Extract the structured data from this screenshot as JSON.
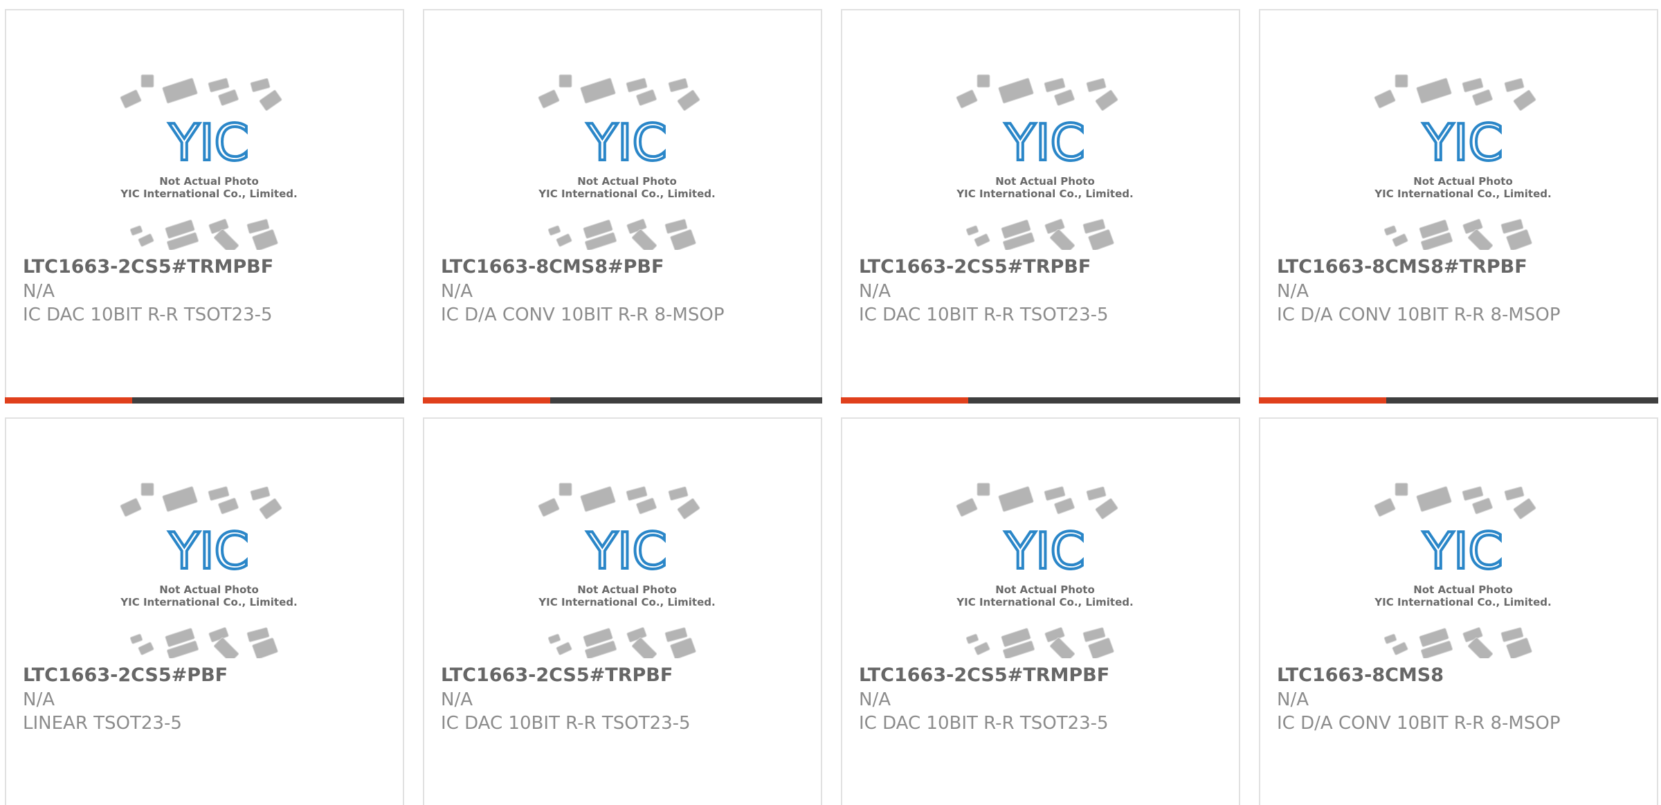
{
  "colors": {
    "accent": "#e0401c",
    "bar": "#3f3f3f",
    "logo_blue": "#2a86c8",
    "chip_gray": "#b4b4b4"
  },
  "placeholder": {
    "logo_text": "YIC",
    "line1": "Not Actual Photo",
    "line2": "YIC International Co., Limited."
  },
  "products": [
    {
      "part": "LTC1663-2CS5#TRMPBF",
      "manufacturer": "N/A",
      "description": "IC DAC 10BIT R-R TSOT23-5",
      "has_bar": true
    },
    {
      "part": "LTC1663-8CMS8#PBF",
      "manufacturer": "N/A",
      "description": "IC D/A CONV 10BIT R-R 8-MSOP",
      "has_bar": true
    },
    {
      "part": "LTC1663-2CS5#TRPBF",
      "manufacturer": "N/A",
      "description": "IC DAC 10BIT R-R TSOT23-5",
      "has_bar": true
    },
    {
      "part": "LTC1663-8CMS8#TRPBF",
      "manufacturer": "N/A",
      "description": "IC D/A CONV 10BIT R-R 8-MSOP",
      "has_bar": true
    },
    {
      "part": "LTC1663-2CS5#PBF",
      "manufacturer": "N/A",
      "description": "LINEAR TSOT23-5",
      "has_bar": false
    },
    {
      "part": "LTC1663-2CS5#TRPBF",
      "manufacturer": "N/A",
      "description": "IC DAC 10BIT R-R TSOT23-5",
      "has_bar": false
    },
    {
      "part": "LTC1663-2CS5#TRMPBF",
      "manufacturer": "N/A",
      "description": "IC DAC 10BIT R-R TSOT23-5",
      "has_bar": false
    },
    {
      "part": "LTC1663-8CMS8",
      "manufacturer": "N/A",
      "description": "IC D/A CONV 10BIT R-R 8-MSOP",
      "has_bar": false
    }
  ]
}
